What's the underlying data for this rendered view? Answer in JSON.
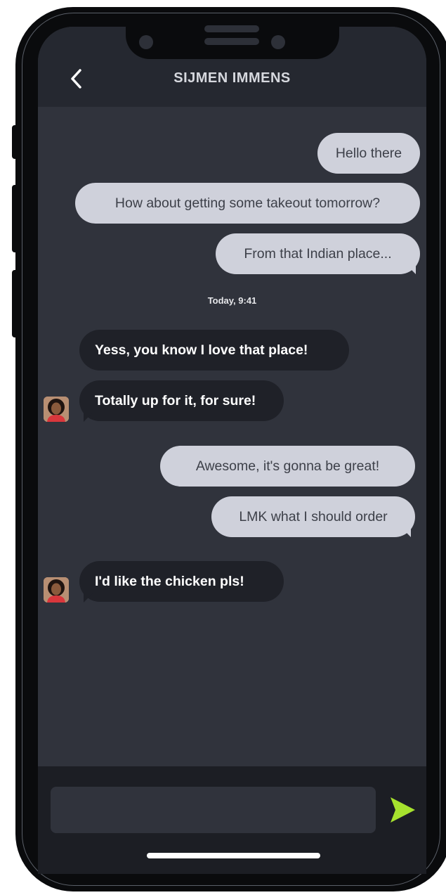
{
  "header": {
    "title": "SIJMEN IMMENS",
    "back_icon": "chevron-left-icon"
  },
  "messages": [
    {
      "direction": "outgoing",
      "text": "Hello there"
    },
    {
      "direction": "outgoing",
      "text": "How about getting some takeout tomorrow?"
    },
    {
      "direction": "outgoing",
      "text": "From that Indian place..."
    },
    {
      "direction": "incoming",
      "text": "Yess, you know I love that place!"
    },
    {
      "direction": "incoming",
      "text": "Totally up for it, for sure!"
    },
    {
      "direction": "outgoing",
      "text": "Awesome, it's gonna be great!"
    },
    {
      "direction": "outgoing",
      "text": "LMK what I should order"
    },
    {
      "direction": "incoming",
      "text": "I'd like the chicken pls!"
    }
  ],
  "timestamp": "Today, 9:41",
  "composer": {
    "placeholder": "",
    "value": "",
    "send_icon": "send-arrow-icon"
  },
  "colors": {
    "background": "#30333c",
    "header": "#252830",
    "outgoing_bubble": "#cfd1db",
    "incoming_bubble": "#1f2128",
    "send_accent": "#a6e22e"
  }
}
